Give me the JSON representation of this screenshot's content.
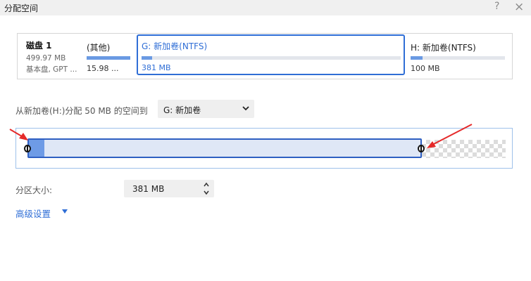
{
  "window": {
    "title": "分配空间",
    "help_glyph": "?",
    "close_glyph": "×"
  },
  "disk": {
    "name": "磁盘 1",
    "size": "499.97 MB",
    "type": "基本盘, GPT ..."
  },
  "partitions": [
    {
      "name": "(其他)",
      "size": "15.98 ...",
      "usage_fraction": 1.0
    },
    {
      "name": "G: 新加卷(NTFS)",
      "size": "381 MB",
      "usage_fraction": 0.04,
      "selected": true
    },
    {
      "name": "H: 新加卷(NTFS)",
      "size": "100 MB",
      "usage_fraction": 0.13
    }
  ],
  "allocate": {
    "label": "从新加卷(H:)分配 50 MB 的空间到",
    "target": "G: 新加卷"
  },
  "partition_size": {
    "label": "分区大小:",
    "value": "381 MB"
  },
  "advanced": {
    "label": "高级设置"
  },
  "colors": {
    "accent": "#2f6ed6",
    "used_fill": "#6a9ae3",
    "arrow": "#e52a2a"
  }
}
